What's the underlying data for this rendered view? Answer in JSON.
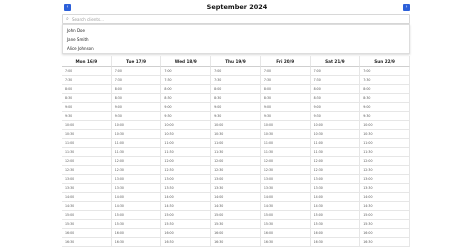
{
  "header": {
    "title": "September 2024",
    "prev_label": "‹",
    "next_label": "›"
  },
  "search": {
    "placeholder": "Search clients...",
    "icon": "search-icon"
  },
  "dropdown": {
    "items": [
      "John Doe",
      "Jane Smith",
      "Alice Johnson"
    ]
  },
  "calendar": {
    "days": [
      "Mon 16/9",
      "Tue 17/9",
      "Wed 18/9",
      "Thu 19/9",
      "Fri 20/9",
      "Sat 21/9",
      "Sun 22/9"
    ],
    "times": [
      "7:00",
      "7:30",
      "8:00",
      "8:30",
      "9:00",
      "9:30",
      "10:00",
      "10:30",
      "11:00",
      "11:30",
      "12:00",
      "12:30",
      "13:00",
      "13:30",
      "14:00",
      "14:30",
      "15:00",
      "15:30",
      "16:00",
      "16:30"
    ]
  },
  "colors": {
    "accent": "#2b5fd9"
  }
}
